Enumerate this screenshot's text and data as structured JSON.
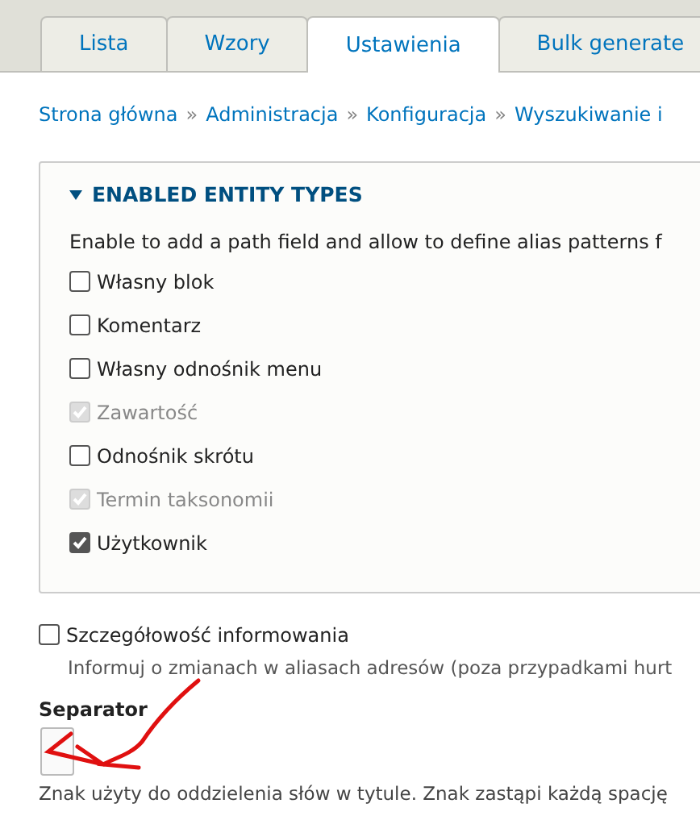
{
  "tabs": [
    {
      "label": "Lista",
      "selected": false
    },
    {
      "label": "Wzory",
      "selected": false
    },
    {
      "label": "Ustawienia",
      "selected": true
    },
    {
      "label": "Bulk generate",
      "selected": false
    }
  ],
  "breadcrumb": [
    {
      "kind": "link",
      "text": "Strona główna"
    },
    {
      "kind": "separator",
      "text": "»"
    },
    {
      "kind": "link",
      "text": "Administracja"
    },
    {
      "kind": "separator",
      "text": "»"
    },
    {
      "kind": "link",
      "text": "Konfiguracja"
    },
    {
      "kind": "separator",
      "text": "»"
    },
    {
      "kind": "link",
      "text": "Wyszukiwanie i"
    }
  ],
  "fieldset": {
    "legend": "ENABLED ENTITY TYPES",
    "expanded": true,
    "description": "Enable to add a path field and allow to define alias patterns f",
    "items": [
      {
        "label": "Własny blok",
        "checked": false,
        "disabled": false
      },
      {
        "label": "Komentarz",
        "checked": false,
        "disabled": false
      },
      {
        "label": "Własny odnośnik menu",
        "checked": false,
        "disabled": false
      },
      {
        "label": "Zawartość",
        "checked": true,
        "disabled": true
      },
      {
        "label": "Odnośnik skrótu",
        "checked": false,
        "disabled": false
      },
      {
        "label": "Termin taksonomii",
        "checked": true,
        "disabled": true
      },
      {
        "label": "Użytkownik",
        "checked": true,
        "disabled": false
      }
    ]
  },
  "verbose": {
    "label": "Szczegółowość informowania",
    "checked": false,
    "description": "Informuj o zmianach w aliasach adresów (poza przypadkami hurt"
  },
  "separator": {
    "label": "Separator",
    "description": "Znak użyty do oddzielenia słów w tytule. Znak zastąpi każdą spację"
  }
}
